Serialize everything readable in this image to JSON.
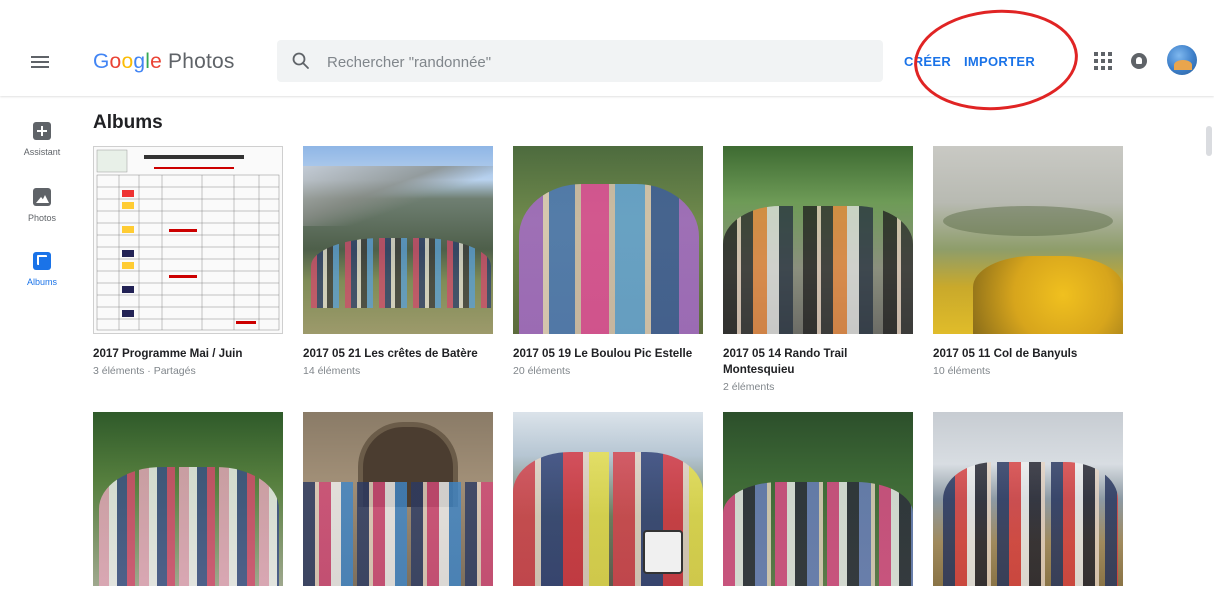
{
  "app": {
    "logo_letters": [
      "G",
      "o",
      "o",
      "g",
      "l",
      "e"
    ],
    "logo_product": "Photos"
  },
  "search": {
    "placeholder": "Rechercher \"randonnée\""
  },
  "actions": {
    "create": "CRÉER",
    "import": "IMPORTER"
  },
  "nav": [
    {
      "label": "Assistant",
      "icon": "assistant-icon"
    },
    {
      "label": "Photos",
      "icon": "photos-icon"
    },
    {
      "label": "Albums",
      "icon": "albums-icon",
      "active": true
    }
  ],
  "section": {
    "title": "Albums"
  },
  "albums": [
    {
      "title": "2017 Programme Mai / Juin",
      "subtitle": "3 éléments · Partagés"
    },
    {
      "title": "2017 05 21 Les crêtes de Batère",
      "subtitle": "14 éléments"
    },
    {
      "title": "2017 05 19 Le Boulou Pic Estelle",
      "subtitle": "20 éléments"
    },
    {
      "title": "2017 05 14 Rando Trail Montesquieu",
      "subtitle": "2 éléments"
    },
    {
      "title": "2017 05 11 Col de Banyuls",
      "subtitle": "10 éléments"
    },
    {
      "title": "",
      "subtitle": ""
    },
    {
      "title": "",
      "subtitle": ""
    },
    {
      "title": "",
      "subtitle": ""
    },
    {
      "title": "",
      "subtitle": ""
    },
    {
      "title": "",
      "subtitle": ""
    }
  ],
  "colors": {
    "accent": "#1a73e8",
    "annotation": "#e02424"
  }
}
